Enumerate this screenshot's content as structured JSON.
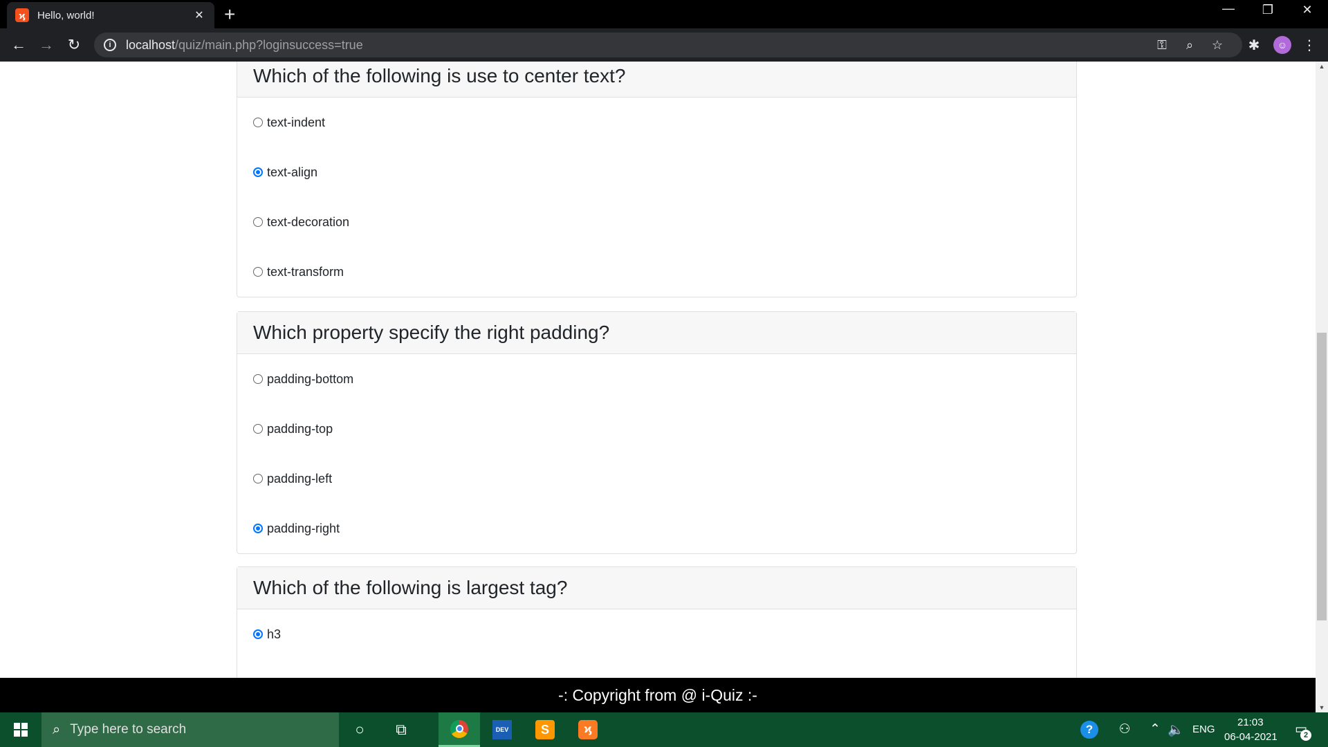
{
  "browser": {
    "tab_title": "Hello, world!",
    "tab_close": "✕",
    "new_tab": "+",
    "url_host": "localhost",
    "url_path": "/quiz/main.php?loginsuccess=true",
    "window_controls": {
      "minimize": "—",
      "restore": "❐",
      "close": "✕"
    },
    "nav": {
      "back": "←",
      "forward": "→",
      "reload": "↻"
    }
  },
  "questions": [
    {
      "title": "Which of the following is use to center text?",
      "options": [
        {
          "label": "text-indent",
          "checked": false
        },
        {
          "label": "text-align",
          "checked": true
        },
        {
          "label": "text-decoration",
          "checked": false
        },
        {
          "label": "text-transform",
          "checked": false
        }
      ]
    },
    {
      "title": "Which property specify the right padding?",
      "options": [
        {
          "label": "padding-bottom",
          "checked": false
        },
        {
          "label": "padding-top",
          "checked": false
        },
        {
          "label": "padding-left",
          "checked": false
        },
        {
          "label": "padding-right",
          "checked": true
        }
      ]
    },
    {
      "title": "Which of the following is largest tag?",
      "options": [
        {
          "label": "h3",
          "checked": true
        }
      ]
    }
  ],
  "footer": {
    "text": "-: Copyright from @ i-Quiz :-"
  },
  "taskbar": {
    "search_placeholder": "Type here to search",
    "apps": [
      "cortana-icon",
      "task-view-icon",
      "chrome-icon",
      "devcpp-icon",
      "sublime-icon",
      "xampp-icon"
    ],
    "dev_label": "DEV",
    "sublime_label": "S",
    "xampp_label": "ϗ",
    "language": "ENG",
    "time": "21:03",
    "date": "06-04-2021",
    "notification_count": "2"
  }
}
